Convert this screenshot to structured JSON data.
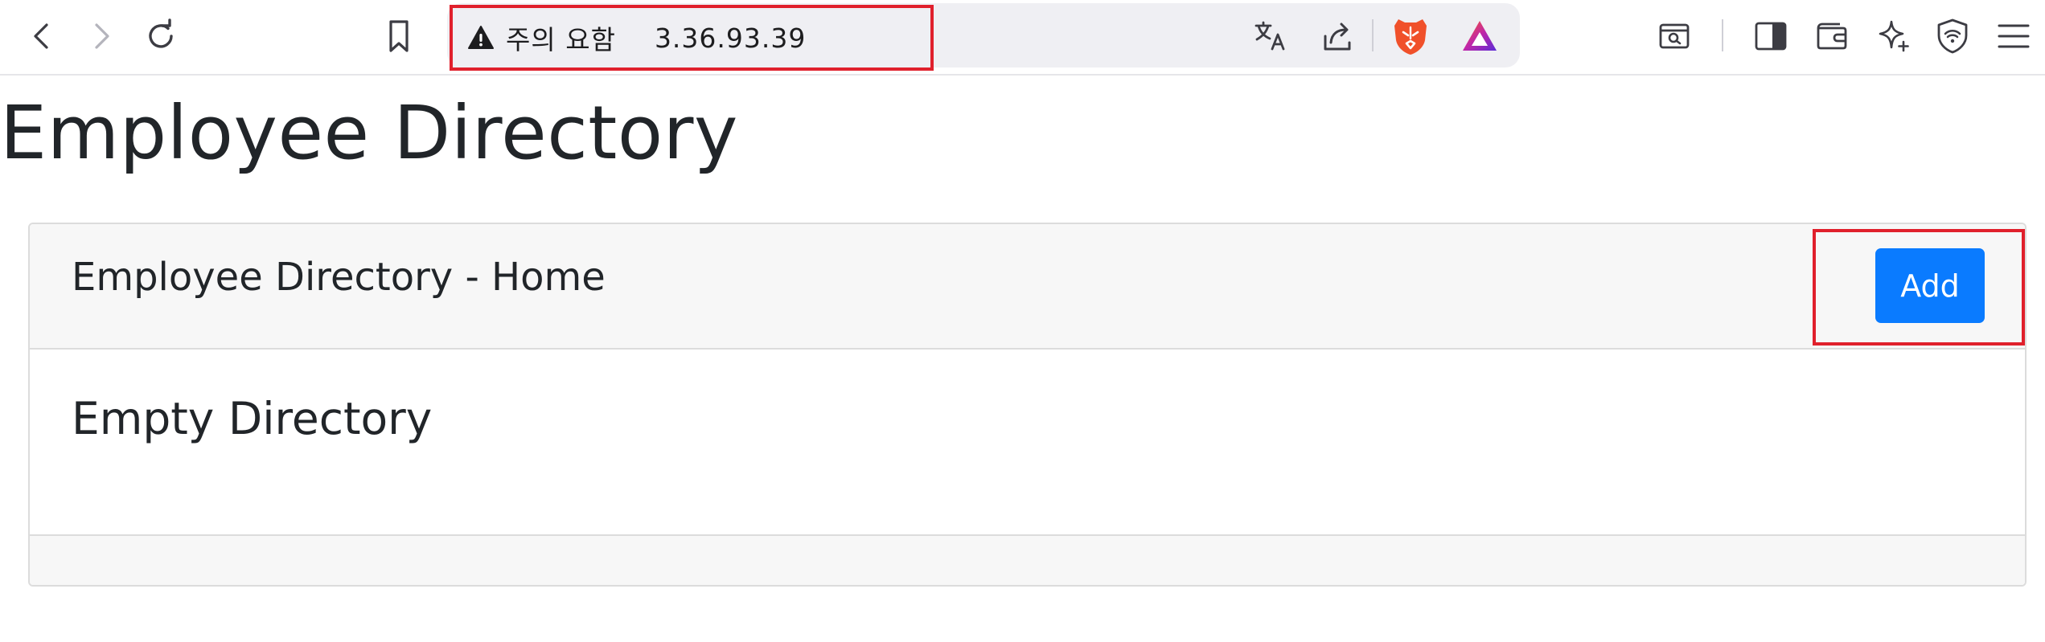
{
  "browser": {
    "security_label": "주의 요함",
    "url": "3.36.93.39",
    "icons": {
      "back": "chevron-left-icon",
      "forward": "chevron-right-icon",
      "reload": "reload-icon",
      "bookmark": "bookmark-icon",
      "warning": "warning-triangle-icon",
      "translate": "translate-icon",
      "share": "share-icon",
      "brave_shields": "brave-lion-icon",
      "brave_rewards": "brave-rewards-triangle-icon",
      "screenshot": "screenshot-search-icon",
      "sidebar": "sidebar-icon",
      "wallet": "wallet-icon",
      "leo": "sparkle-icon",
      "vpn": "vpn-shield-icon",
      "menu": "hamburger-menu-icon"
    }
  },
  "page": {
    "title": "Employee Directory"
  },
  "card": {
    "header_title": "Employee Directory - Home",
    "add_button_label": "Add",
    "empty_message": "Empty Directory"
  },
  "colors": {
    "accent": "#0a7bff",
    "highlight": "#e0202c",
    "card_header_bg": "#f7f7f7"
  }
}
